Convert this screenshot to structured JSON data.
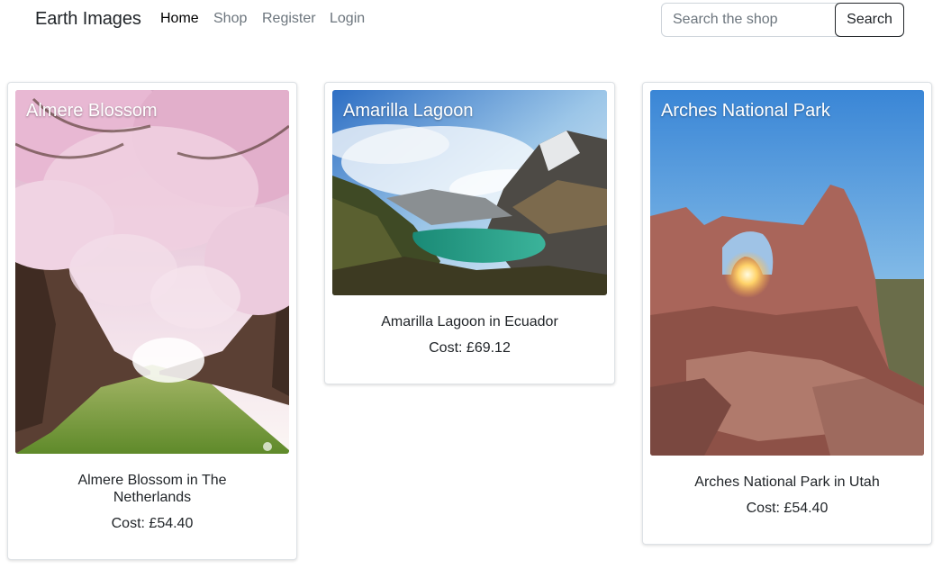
{
  "navbar": {
    "brand": "Earth Images",
    "links": [
      "Home",
      "Shop",
      "Register",
      "Login"
    ],
    "search_placeholder": "Search the shop",
    "search_button": "Search"
  },
  "cards": [
    {
      "image_title": "Almere Blossom",
      "title": "Almere Blossom in The Netherlands",
      "cost": "Cost: £54.40"
    },
    {
      "image_title": "Amarilla Lagoon",
      "title": "Amarilla Lagoon in Ecuador",
      "cost": "Cost: £69.12"
    },
    {
      "image_title": "Arches National Park",
      "title": "Arches National Park in Utah",
      "cost": "Cost: £54.40"
    }
  ],
  "colors": {
    "text": "#212529",
    "muted_link": "#6c757d",
    "border": "#dee2e6"
  }
}
